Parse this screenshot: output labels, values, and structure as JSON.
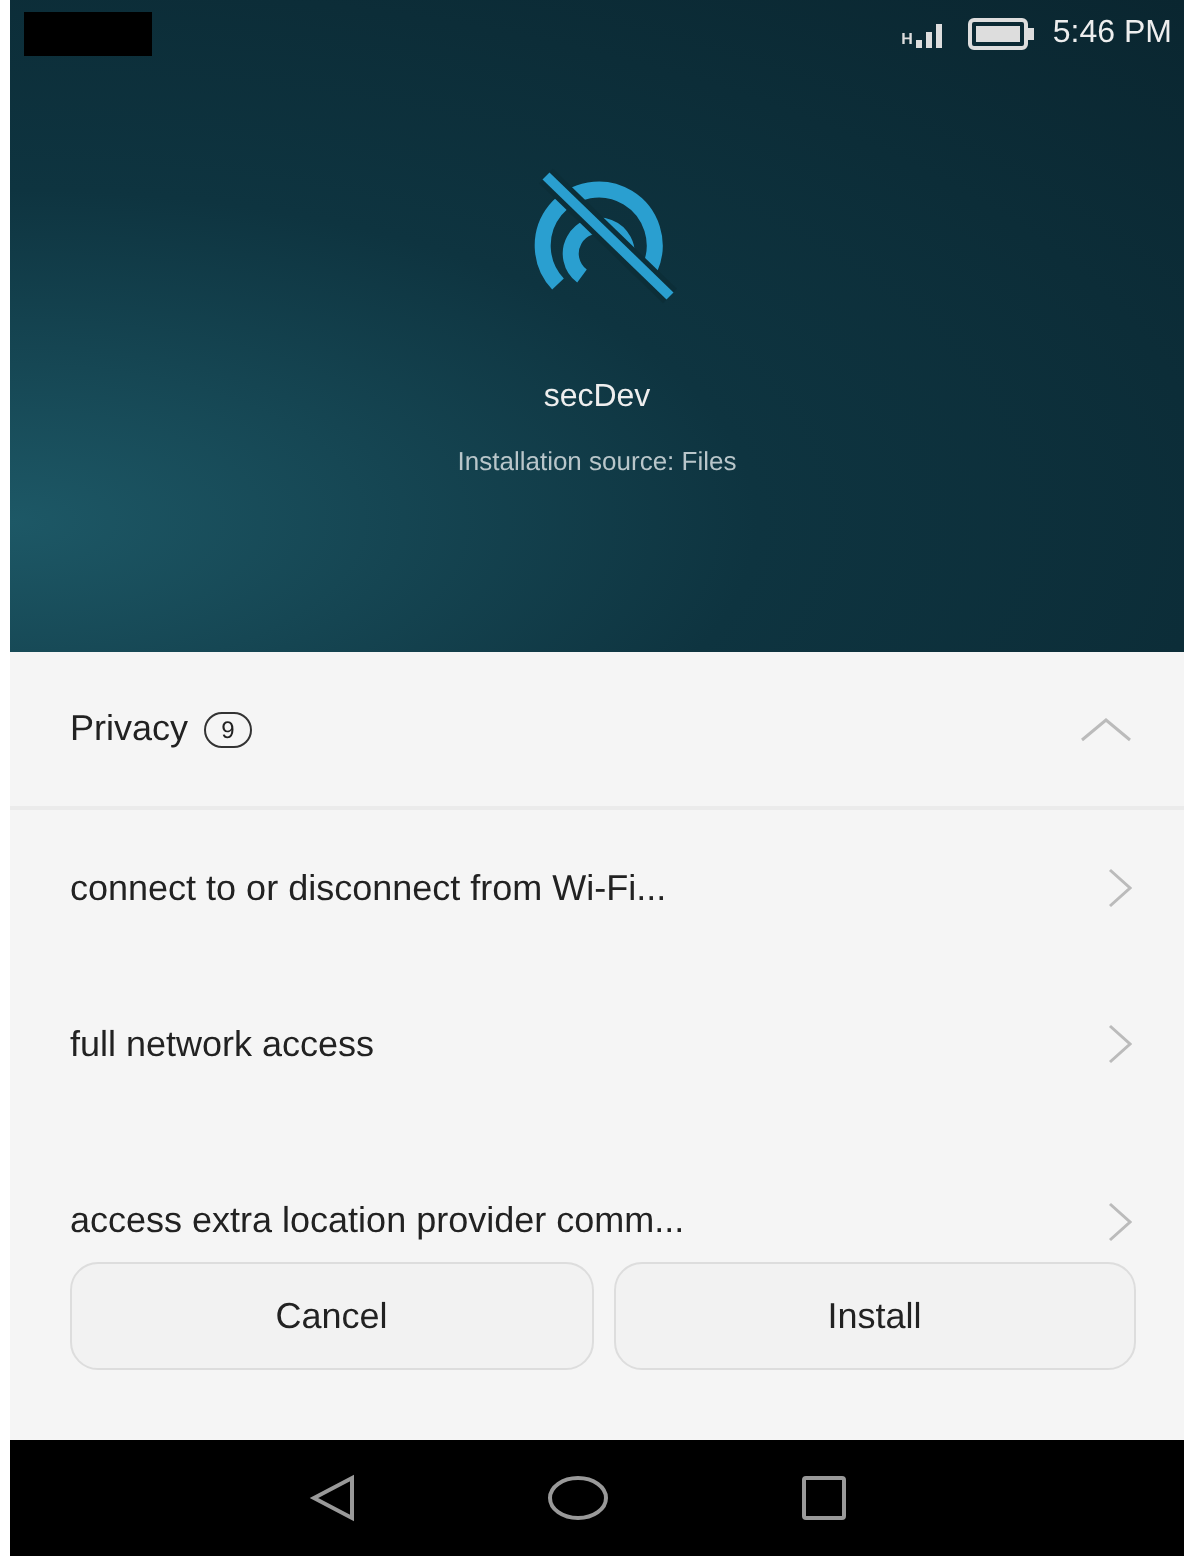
{
  "status_bar": {
    "network": "H",
    "time": "5:46 PM"
  },
  "app": {
    "name": "secDev",
    "source": "Installation source: Files"
  },
  "section": {
    "title": "Privacy",
    "count": "9",
    "expanded": true
  },
  "permissions": [
    {
      "label": "connect to or disconnect from Wi-Fi..."
    },
    {
      "label": "full network access"
    },
    {
      "label": "access extra location provider comm..."
    }
  ],
  "buttons": [
    {
      "label": "Cancel"
    },
    {
      "label": "Install"
    }
  ]
}
